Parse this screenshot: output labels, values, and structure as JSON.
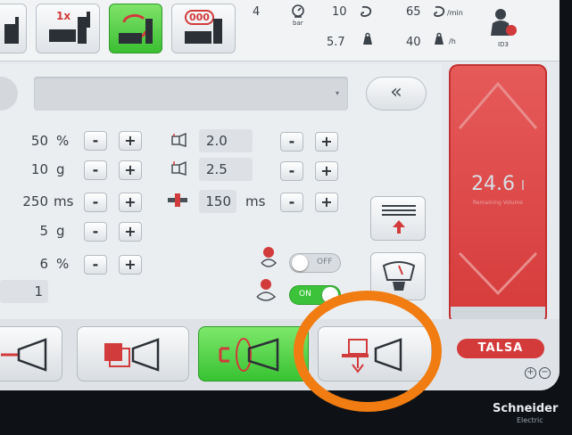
{
  "topbar": {
    "buttons": [
      {
        "name": "mode-button",
        "label": ""
      },
      {
        "name": "single-mode-button",
        "label": "1x"
      },
      {
        "name": "auto-cycle-button",
        "label": ""
      },
      {
        "name": "counter-mode-button",
        "label": "000"
      }
    ],
    "pressure_value": "4",
    "pressure_unit": "bar",
    "cycle_value": "10",
    "cycle_time": "5.7",
    "speed_value": "65",
    "speed_unit": "/min",
    "rate_value": "40",
    "rate_unit": "/h",
    "user_id": "ID3"
  },
  "dropdown": {
    "value": "",
    "arrow": "▾"
  },
  "collapse_label": "«",
  "params_left": [
    {
      "value": "50",
      "unit": "%"
    },
    {
      "value": "10",
      "unit": "g"
    },
    {
      "value": "250",
      "unit": "ms"
    },
    {
      "value": "5",
      "unit": "g"
    },
    {
      "value": "6",
      "unit": "%"
    },
    {
      "value": "1",
      "unit": ""
    }
  ],
  "params_right": [
    {
      "value": "2.0",
      "unit": ""
    },
    {
      "value": "2.5",
      "unit": ""
    },
    {
      "value": "150",
      "unit": "ms"
    }
  ],
  "toggles": [
    {
      "label": "OFF",
      "state": "off"
    },
    {
      "label": "ON",
      "state": "on"
    }
  ],
  "stepper": {
    "minus": "-",
    "plus": "+"
  },
  "gauge": {
    "value": "24.6",
    "unit": "l",
    "caption": "Remaining Volume"
  },
  "brand": "TALSA",
  "zoom": {
    "in": "+",
    "out": "−"
  },
  "footer": {
    "brand": "Schneider",
    "sub": "Electric"
  },
  "colors": {
    "accent_red": "#d63b3b",
    "accent_green": "#3cc33a",
    "highlight_orange": "#f07c12"
  }
}
